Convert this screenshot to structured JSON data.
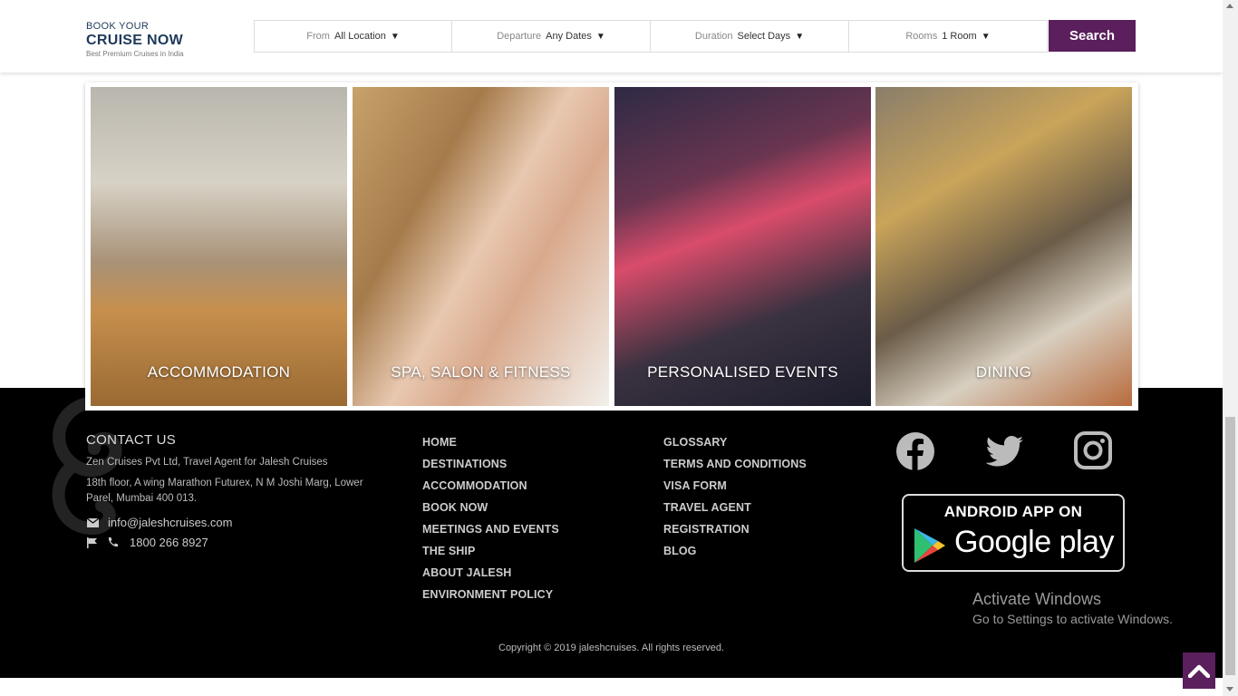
{
  "header": {
    "brand_line1": "BOOK YOUR",
    "brand_line2": "CRUISE NOW",
    "brand_line3": "Best Premium Cruises in India",
    "fields": [
      {
        "label": "From",
        "value": "All Location"
      },
      {
        "label": "Departure",
        "value": "Any Dates"
      },
      {
        "label": "Duration",
        "value": "Select Days"
      },
      {
        "label": "Rooms",
        "value": "1 Room"
      }
    ],
    "search_label": "Search"
  },
  "amenities": [
    {
      "label": "ACCOMMODATION"
    },
    {
      "label": "SPA, SALON & FITNESS"
    },
    {
      "label": "PERSONALISED EVENTS"
    },
    {
      "label": "DINING"
    }
  ],
  "footer": {
    "contact_title": "CONTACT US",
    "company": "Zen Cruises Pvt Ltd, Travel Agent for Jalesh Cruises",
    "address": "18th floor, A wing Marathon Futurex, N M Joshi Marg, Lower Parel, Mumbai 400 013.",
    "email": "info@jaleshcruises.com",
    "phone": "1800 266 8927",
    "links_col1": [
      "HOME",
      "DESTINATIONS",
      "ACCOMMODATION",
      "BOOK NOW",
      "MEETINGS AND EVENTS",
      "THE SHIP",
      "ABOUT JALESH",
      "ENVIRONMENT POLICY"
    ],
    "links_col2": [
      "GLOSSARY",
      "TERMS AND CONDITIONS",
      "VISA FORM",
      "TRAVEL AGENT",
      "REGISTRATION",
      "BLOG"
    ],
    "social_icons": [
      "facebook-icon",
      "twitter-icon",
      "instagram-icon"
    ],
    "app_badge_top": "ANDROID APP ON",
    "app_badge_bottom": "Google play",
    "copyright": "Copyright © 2019 jaleshcruises. All rights reserved."
  },
  "watermark": {
    "line1": "Activate Windows",
    "line2": "Go to Settings to activate Windows."
  },
  "colors": {
    "brand_purple": "#5a1f5c",
    "footer_bg": "#000000",
    "brand_navy": "#1f3a5a"
  }
}
